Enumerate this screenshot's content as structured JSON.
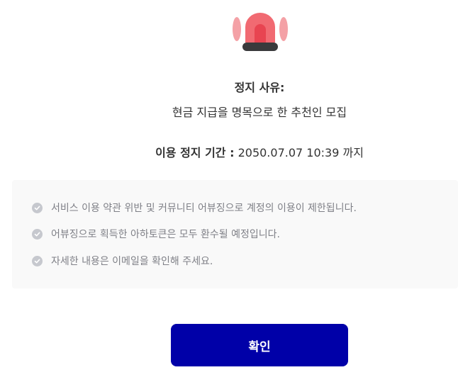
{
  "icons": {
    "siren": "siren-icon",
    "check": "check-circle-icon"
  },
  "colors": {
    "siren_light": "#f16a72",
    "siren_glow": "#f4a1a6",
    "siren_base": "#3a3a3c",
    "button": "#0000a8",
    "notice_bg": "#f9f9f9",
    "notice_text": "#7f8087"
  },
  "suspension": {
    "reason_title": "정지 사유:",
    "reason_text": "현금 지급을 명목으로 한 추천인 모집",
    "period_label": "이용 정지 기간 :",
    "period_value": " 2050.07.07 10:39 까지"
  },
  "notices": [
    "서비스 이용 약관 위반 및 커뮤니티 어뷰징으로 계정의 이용이 제한됩니다.",
    "어뷰징으로 획득한 아하토큰은 모두 환수될 예정입니다.",
    "자세한 내용은 이메일을 확인해 주세요."
  ],
  "confirm_button": "확인"
}
